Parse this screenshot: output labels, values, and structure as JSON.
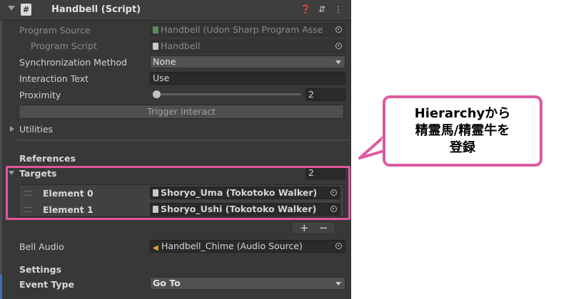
{
  "component": {
    "title": "Handbell (Script)",
    "icon": "script-hash-icon"
  },
  "header_icons": [
    "help-icon",
    "preset-icon",
    "kebab-menu-icon"
  ],
  "fields": {
    "program_source": {
      "label": "Program Source",
      "value": "Handbell (Udon Sharp Program Asse"
    },
    "program_script": {
      "label": "Program Script",
      "value": "Handbell"
    },
    "sync_method": {
      "label": "Synchronization Method",
      "value": "None"
    },
    "interaction_text": {
      "label": "Interaction Text",
      "value": "Use"
    },
    "proximity": {
      "label": "Proximity",
      "value": "2",
      "slider_fraction": 0.0
    },
    "trigger_button": "Trigger Interact",
    "utilities": "Utilities",
    "references": "References",
    "targets": {
      "label": "Targets",
      "size": "2",
      "elements": [
        {
          "label": "Element 0",
          "value": "Shoryo_Uma (Tokotoko Walker)"
        },
        {
          "label": "Element 1",
          "value": "Shoryo_Ushi (Tokotoko Walker)"
        }
      ],
      "add": "+",
      "remove": "−"
    },
    "bell_audio": {
      "label": "Bell Audio",
      "value": "Handbell_Chime (Audio Source)"
    },
    "settings": "Settings",
    "event_type": {
      "label": "Event Type",
      "value": "Go To"
    }
  },
  "callout": {
    "text": "Hierarchyから\n精霊馬/精霊牛を\n登録"
  },
  "colors": {
    "panel_bg": "#383838",
    "highlight": "#e0579b",
    "callout_border": "#dc5ba2"
  }
}
